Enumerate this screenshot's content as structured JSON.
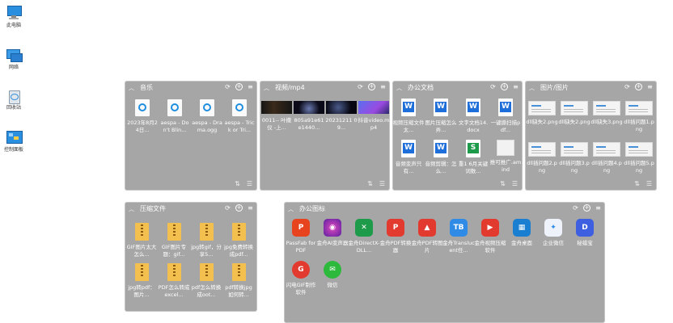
{
  "desktop": {
    "icons": [
      {
        "label": "此电脑",
        "icon": "computer-icon"
      },
      {
        "label": "网络",
        "icon": "network-icon"
      },
      {
        "label": "回收站",
        "icon": "recycle-bin-icon"
      },
      {
        "label": "控制面板",
        "icon": "control-panel-icon"
      }
    ]
  },
  "fences": [
    {
      "title": "音乐",
      "items": [
        {
          "name": "2023年8月24日...",
          "icon": "audio-file-icon"
        },
        {
          "name": "aespa - Don't Blin...",
          "icon": "audio-file-icon"
        },
        {
          "name": "aespa - Drama.ogg",
          "icon": "audio-file-icon"
        },
        {
          "name": "aespa - Trick or Tri...",
          "icon": "audio-file-icon"
        }
      ]
    },
    {
      "title": "视频/mp4",
      "items": [
        {
          "name": "0011-- 叶撒仪 -上...",
          "icon": "video-thumb-icon"
        },
        {
          "name": "805a91e61e1440...",
          "icon": "video-thumb-icon"
        },
        {
          "name": "20231211 09...",
          "icon": "video-thumb-icon"
        },
        {
          "name": "抖音video.mp4",
          "icon": "video-thumb-icon"
        }
      ]
    },
    {
      "title": "办公文档",
      "items": [
        {
          "name": "视频压缩文件太...",
          "icon": "word-doc-icon"
        },
        {
          "name": "图片压缩怎么弄...",
          "icon": "word-doc-icon"
        },
        {
          "name": "文字文档14.docx",
          "icon": "word-doc-icon"
        },
        {
          "name": "一键撕扫描pdf...",
          "icon": "word-doc-icon"
        },
        {
          "name": "音频变声只有...",
          "icon": "word-doc-icon"
        },
        {
          "name": "音频剪辑：怎么...",
          "icon": "word-doc-icon"
        },
        {
          "name": "重1 6月关键词数...",
          "icon": "sheet-doc-icon"
        },
        {
          "name": "推可推广.amind",
          "icon": "mind-file-icon"
        }
      ]
    },
    {
      "title": "图片/图片",
      "items": [
        {
          "name": "dll缺失2.png",
          "icon": "image-file-icon"
        },
        {
          "name": "dll缺失2.png",
          "icon": "image-file-icon"
        },
        {
          "name": "dll缺失3.png",
          "icon": "image-file-icon"
        },
        {
          "name": "dll插问题1.png",
          "icon": "image-file-icon"
        },
        {
          "name": "dll插问题2.png",
          "icon": "image-file-icon"
        },
        {
          "name": "dll插问题3.png",
          "icon": "image-file-icon"
        },
        {
          "name": "dll插问题4.png",
          "icon": "image-file-icon"
        },
        {
          "name": "dll插问题5.png",
          "icon": "image-file-icon"
        }
      ]
    },
    {
      "title": "压缩文件",
      "items": [
        {
          "name": "GIF图片太大怎么...",
          "icon": "zip-file-icon"
        },
        {
          "name": "GIF图片专题：gif...",
          "icon": "zip-file-icon"
        },
        {
          "name": "jpg转gif，分享5...",
          "icon": "zip-file-icon"
        },
        {
          "name": "jpg免费转换成pdf...",
          "icon": "zip-file-icon"
        },
        {
          "name": "jpg转pdf：图片...",
          "icon": "zip-file-icon"
        },
        {
          "name": "PDF怎么转成excel...",
          "icon": "zip-file-icon"
        },
        {
          "name": "pdf怎么转换成oot...",
          "icon": "zip-file-icon"
        },
        {
          "name": "pdf转换jpg如何转...",
          "icon": "zip-file-icon"
        }
      ]
    },
    {
      "title": "办公图标",
      "items": [
        {
          "name": "PassFab for PDF",
          "icon": "passfab-app-icon",
          "color": "#e8431f",
          "glyph": "P"
        },
        {
          "name": "金舟AI变声器",
          "icon": "voice-changer-app-icon",
          "color": "#7b2fbf",
          "glyph": "◉"
        },
        {
          "name": "金舟DirectX-DLL...",
          "icon": "directx-repair-app-icon",
          "color": "#1e9b4a",
          "glyph": "✕"
        },
        {
          "name": "金舟PDF转换器",
          "icon": "pdf-converter-app-icon",
          "color": "#e23a2e",
          "glyph": "P"
        },
        {
          "name": "金舟PDF转图片",
          "icon": "pdf-to-image-app-icon",
          "color": "#e23a2e",
          "glyph": "▲"
        },
        {
          "name": "金舟Translucent任...",
          "icon": "translucent-app-icon",
          "color": "#2f8be6",
          "glyph": "TB"
        },
        {
          "name": "金舟视频压缩软件",
          "icon": "video-compress-app-icon",
          "color": "#e23a2e",
          "glyph": "▶"
        },
        {
          "name": "金舟桌面",
          "icon": "desktop-organizer-app-icon",
          "color": "#1a7fd1",
          "glyph": "▦"
        },
        {
          "name": "企业微信",
          "icon": "wecom-app-icon",
          "color": "#e8eef8",
          "glyph": "✦"
        },
        {
          "name": "秘蜡宝",
          "icon": "mila-app-icon",
          "color": "#3e5fe0",
          "glyph": "D"
        },
        {
          "name": "闪电GIF制作软件",
          "icon": "gif-maker-app-icon",
          "color": "#e23a2e",
          "glyph": "G"
        },
        {
          "name": "微信",
          "icon": "wechat-app-icon",
          "color": "#2db93c",
          "glyph": "✉"
        }
      ]
    }
  ],
  "colors": {
    "fence_bg": "#a6a6a6",
    "desktop_bg": "#ffffff"
  }
}
